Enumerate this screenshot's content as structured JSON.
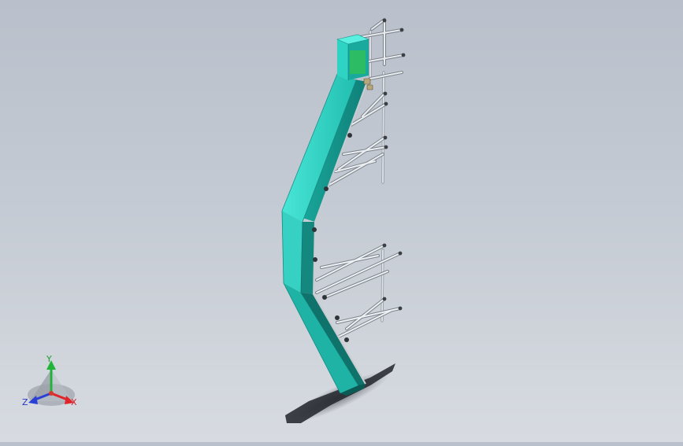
{
  "viewport": {
    "colors": {
      "background_top": "#b9c0cb",
      "background_bottom": "#d7dbe1",
      "chute_light": "#3ee0d0",
      "chute_mid": "#22b7aa",
      "chute_dark": "#138a82",
      "frame": "#d9dde2",
      "frame_shade": "#7e858e",
      "hopper_green": "#2fbf5a",
      "shadow": "#2e3238"
    },
    "model": "bent-chute-with-support-frame"
  },
  "triad": {
    "x_label": "X",
    "y_label": "Y",
    "z_label": "Z",
    "colors": {
      "x": "#e0252a",
      "y": "#22b33a",
      "z": "#2a3fd6"
    }
  }
}
